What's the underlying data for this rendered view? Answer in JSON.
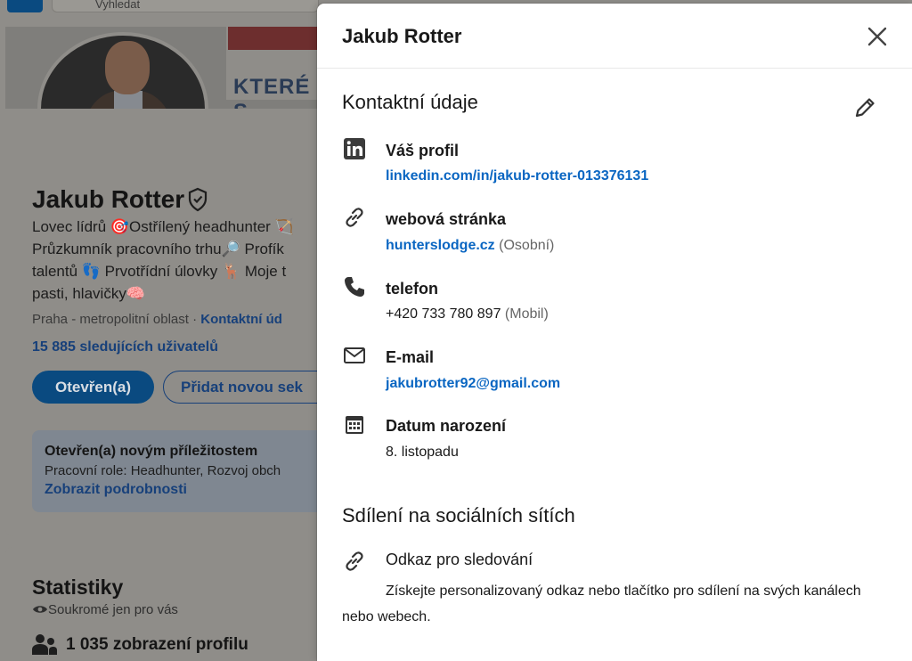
{
  "background": {
    "search_placeholder": "Vyhledat",
    "cover_text": "KTERÉ S",
    "profile": {
      "name": "Jakub Rotter",
      "headline": "Lovec lídrů 🎯Ostřílený headhunter 🏹\nPrůzkumník pracovního trhu🔎 Profík\ntalentů 👣 Prvotřídní úlovky 🦌 Moje t\npasti, hlavičky🧠",
      "location": "Praha - metropolitní oblast · ",
      "contact_link": "Kontaktní úd",
      "followers": "15 885 sledujících uživatelů",
      "open_button": "Otevřen(a)",
      "add_button": "Přidat novou sek"
    },
    "open_to_work": {
      "title": "Otevřen(a) novým příležitostem",
      "role": "Pracovní role: Headhunter, Rozvoj obch",
      "link": "Zobrazit podrobnosti"
    },
    "stats": {
      "title": "Statistiky",
      "private": "Soukromé jen pro vás",
      "views": "1 035 zobrazení profilu"
    }
  },
  "modal": {
    "title": "Jakub Rotter",
    "contact_section": "Kontaktní údaje",
    "items": [
      {
        "icon": "linkedin-icon",
        "label": "Váš profil",
        "value": "linkedin.com/in/jakub-rotter-013376131",
        "note": ""
      },
      {
        "icon": "link-icon",
        "label": "webová stránka",
        "value": "hunterslodge.cz",
        "note": "(Osobní)"
      },
      {
        "icon": "phone-icon",
        "label": "telefon",
        "value": "+420 733 780 897",
        "note": "(Mobil)"
      },
      {
        "icon": "envelope-icon",
        "label": "E-mail",
        "value": "jakubrotter92@gmail.com",
        "note": ""
      },
      {
        "icon": "calendar-icon",
        "label": "Datum narození",
        "value": "8. listopadu",
        "note": ""
      }
    ],
    "social_section": "Sdílení na sociálních sítích",
    "share": {
      "label": "Odkaz pro sledování",
      "description": "Získejte personalizovaný odkaz nebo tlačítko pro sdílení na svých kanálech nebo webech."
    }
  },
  "colors": {
    "link": "#0a66c2",
    "text": "#191919",
    "muted": "#666666",
    "overlay": "#8f8d89"
  }
}
